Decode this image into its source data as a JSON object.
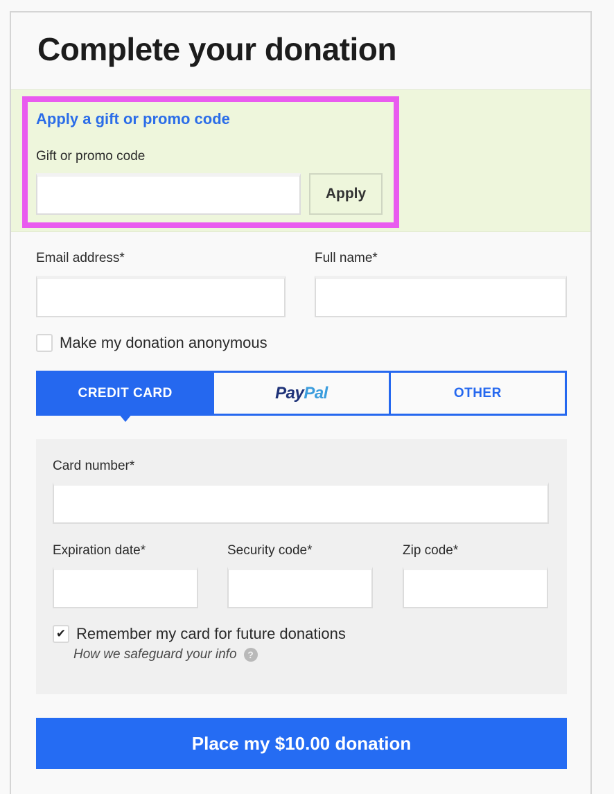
{
  "page": {
    "title": "Complete your donation"
  },
  "promo": {
    "heading": "Apply a gift or promo code",
    "label": "Gift or promo code",
    "input_value": "",
    "input_placeholder": "",
    "apply_label": "Apply",
    "highlight_color": "#e95bef"
  },
  "contact": {
    "email_label": "Email address*",
    "email_value": "",
    "name_label": "Full name*",
    "name_value": "",
    "anonymous_label": "Make my donation anonymous",
    "anonymous_checked": false
  },
  "payment_tabs": [
    {
      "label": "CREDIT CARD",
      "active": true
    },
    {
      "label_part1": "Pay",
      "label_part2": "Pal",
      "active": false
    },
    {
      "label": "OTHER",
      "active": false
    }
  ],
  "card": {
    "number_label": "Card number*",
    "number_value": "",
    "expiration_label": "Expiration date*",
    "expiration_value": "",
    "security_label": "Security code*",
    "security_value": "",
    "zip_label": "Zip code*",
    "zip_value": "",
    "remember_label": "Remember my card for future donations",
    "remember_checked": true,
    "remember_check_glyph": "✔",
    "safeguard_text": "How we safeguard your info",
    "help_glyph": "?"
  },
  "submit": {
    "label": "Place my $10.00 donation",
    "color": "#256cf3"
  }
}
